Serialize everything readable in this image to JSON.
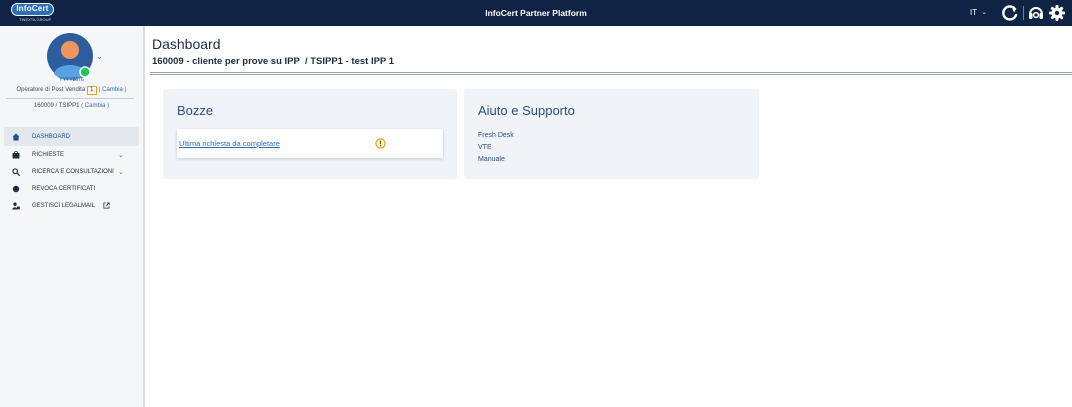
{
  "header": {
    "logo_text": "InfoCert",
    "logo_subtext": "TINEXTA GROUP",
    "app_title": "InfoCert Partner Platform",
    "language": "IT",
    "icons": [
      "refresh-icon",
      "support-headset-icon",
      "gear-icon"
    ]
  },
  "sidebar": {
    "user_code": "YYYY8676",
    "role": "Operatore di Post Vendita",
    "role_badge": "1",
    "change_label": "( Cambia )",
    "account": "160009  / TSIPP1",
    "account_change_label": "( Cambia )",
    "status_color": "#22c55e",
    "nav": [
      {
        "label": "DASHBOARD",
        "icon": "home-icon",
        "active": true
      },
      {
        "label": "RICHIESTE",
        "icon": "briefcase-icon",
        "expandable": true
      },
      {
        "label": "RICERCA E CONSULTAZIONI",
        "icon": "search-icon",
        "expandable": true
      },
      {
        "label": "REVOCA CERTIFICATI",
        "icon": "certificate-icon"
      },
      {
        "label": "GESTISCI LEGALMAIL",
        "icon": "mail-manage-icon",
        "external": true
      }
    ]
  },
  "main": {
    "title": "Dashboard",
    "context": "160009 - cliente per prove su IPP  / TSIPP1 - test IPP 1",
    "bozze": {
      "title": "Bozze",
      "item_label": "Ultima richiesta da completare"
    },
    "support": {
      "title": "Aiuto e Supporto",
      "links": [
        "Fresh Desk",
        "VTE",
        "Manuale"
      ]
    }
  },
  "colors": {
    "header_bg": "#0f2344",
    "accent": "#2f6db5",
    "card_bg": "#f0f3f7",
    "warning": "#e1a21a"
  }
}
